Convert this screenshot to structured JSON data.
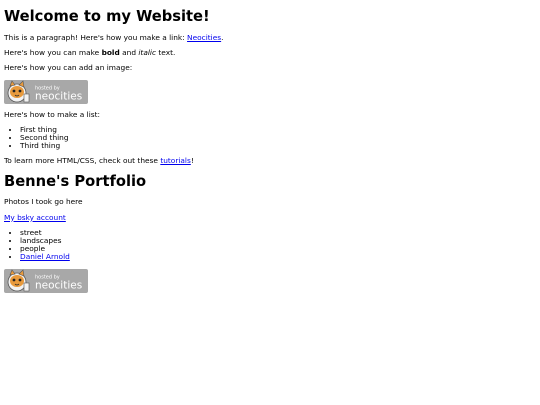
{
  "page": {
    "title": "Welcome to my Website!",
    "intro_text": "This is a paragraph! Here's how you make a link: ",
    "intro_link": "Neocities",
    "intro_after": ".",
    "bold_prefix": "Here's how you can make ",
    "bold_word": "bold",
    "bold_and": " and ",
    "italic_word": "italic",
    "bold_suffix": " text.",
    "image_text": "Here's how you can add an image:",
    "badge_small": "hosted by",
    "badge_big": "neocities",
    "list_intro": "Here's how to make a list:",
    "list_items": [
      "First thing",
      "Second thing",
      "Third thing"
    ],
    "learn_prefix": "To learn more HTML/CSS, check out these ",
    "learn_link": "tutorials",
    "learn_suffix": "!"
  },
  "portfolio": {
    "title": "Benne's Portfolio",
    "photos_text": "Photos I took go here",
    "bsky_link": "My bsky account",
    "items": [
      "street",
      "landscapes",
      "people"
    ],
    "link_item": "Daniel Arnold"
  },
  "colors": {
    "link": "#0000ee",
    "badge_bg": "#a8a8a8",
    "badge_text": "#ffffff"
  }
}
